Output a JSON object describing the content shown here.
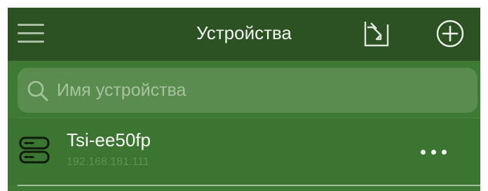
{
  "header": {
    "title": "Устройства",
    "menu_icon": "hamburger-menu-icon",
    "import_icon": "import-device-icon",
    "add_icon": "plus-circle-icon"
  },
  "search": {
    "placeholder": "Имя устройства",
    "icon": "search-icon"
  },
  "devices": [
    {
      "name": "Tsi-ee50fp",
      "ip": "192.168.181.111",
      "icon": "server-icon",
      "actions_icon": "more-dots-icon"
    }
  ],
  "colors": {
    "header_bg": "#2c5122",
    "body_bg": "#3f7a35",
    "search_bg": "#5a8c50",
    "text_primary": "#f2f4f0",
    "text_muted": "#5f8f55"
  }
}
